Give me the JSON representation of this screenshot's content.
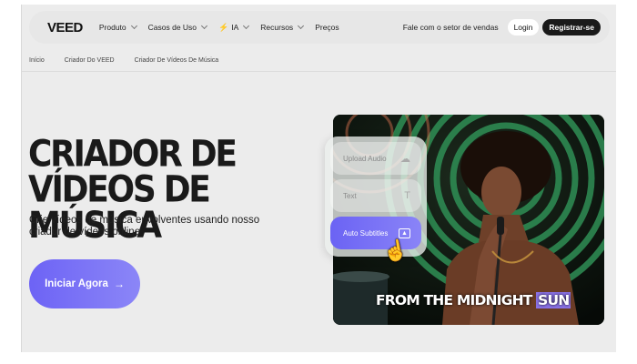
{
  "header": {
    "logo": "VEED",
    "nav": [
      {
        "label": "Produto",
        "dropdown": true
      },
      {
        "label": "Casos de Uso",
        "dropdown": true
      },
      {
        "label": "IA",
        "dropdown": true,
        "icon": "lightning-icon"
      },
      {
        "label": "Recursos",
        "dropdown": true
      },
      {
        "label": "Preços",
        "dropdown": false
      }
    ],
    "sales_link": "Fale com o setor de vendas",
    "login_label": "Login",
    "signup_label": "Registrar-se"
  },
  "breadcrumb": [
    "Início",
    "Criador Do VEED",
    "Criador De Vídeos De Música"
  ],
  "hero": {
    "title": "CRIADOR DE VÍDEOS DE MÚSICA",
    "subtitle": "Crie vídeos de música envolventes usando nosso criador de vídeos online",
    "cta_label": "Iniciar Agora",
    "cta_icon": "arrow-right-icon"
  },
  "media": {
    "caption_prefix": "FROM THE MIDNIGHT ",
    "caption_highlight": "SUN",
    "highlight_color": "#8a72e6"
  },
  "panel": {
    "items": [
      {
        "label": "Upload Audio",
        "icon": "upload-cloud-icon",
        "active": false
      },
      {
        "label": "Text",
        "icon": "text-icon",
        "active": false
      },
      {
        "label": "Auto Subtitles",
        "icon": "subtitles-icon",
        "active": true
      }
    ]
  },
  "colors": {
    "accent": "#6d63f5",
    "background": "#ececec",
    "dark_button": "#1a1a1a"
  }
}
